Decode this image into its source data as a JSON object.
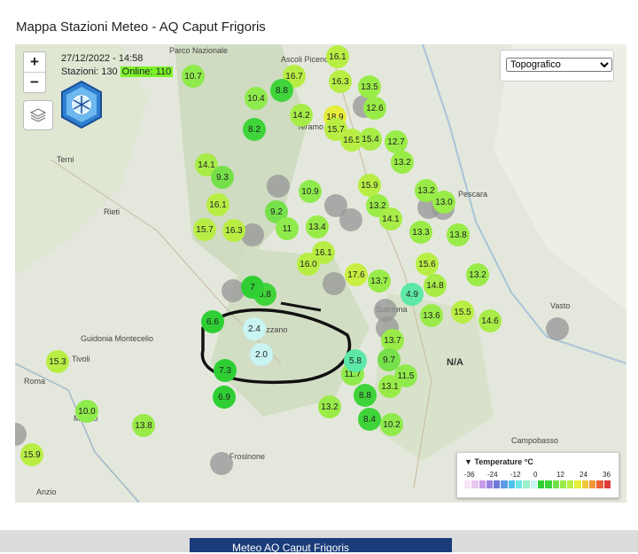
{
  "page": {
    "title": "Mappa Stazioni Meteo - AQ Caput Frigoris"
  },
  "map": {
    "zoom_in": "+",
    "zoom_out": "−",
    "timestamp": "27/12/2022 - 14:58",
    "stations_label": "Stazioni: 130",
    "online_label": "Online: 110",
    "layer_select": {
      "selected": "Topografico",
      "options": [
        "Topografico"
      ]
    },
    "na_label": "N/A",
    "place_labels": [
      "Ascoli Piceno",
      "Teramo",
      "Terni",
      "Rieti",
      "Pescara",
      "Vasto",
      "Roma",
      "Guidonia Montecelio",
      "Frosinone",
      "Campobasso",
      "Sulmona",
      "Avezzano",
      "Tivoli",
      "Marino",
      "Anzio"
    ],
    "stations": [
      {
        "t": "16.1",
        "c": "#b8ee44"
      },
      {
        "t": "16.7",
        "c": "#b8ee44"
      },
      {
        "t": "10.7",
        "c": "#8fea4c"
      },
      {
        "t": "8.8",
        "c": "#3fd43a"
      },
      {
        "t": "16.3",
        "c": "#b8ee44"
      },
      {
        "t": "13.5",
        "c": "#99eb48"
      },
      {
        "t": "10.4",
        "c": "#8fea4c"
      },
      {
        "t": "14.2",
        "c": "#a8ec47"
      },
      {
        "t": "18.9",
        "c": "#e6ee3a"
      },
      {
        "t": "12.6",
        "c": "#99eb48"
      },
      {
        "t": "8.2",
        "c": "#3fd43a"
      },
      {
        "t": "15.7",
        "c": "#b8ee44"
      },
      {
        "t": "16.5",
        "c": "#b8ee44"
      },
      {
        "t": "15.4",
        "c": "#a8ec47"
      },
      {
        "t": "12.7",
        "c": "#99eb48"
      },
      {
        "t": "14.1",
        "c": "#a8ec47"
      },
      {
        "t": "9.3",
        "c": "#76e04a"
      },
      {
        "t": "13.2",
        "c": "#99eb48"
      },
      {
        "t": "15.9",
        "c": "#b8ee44"
      },
      {
        "t": "13.2",
        "c": "#99eb48"
      },
      {
        "t": "10.9",
        "c": "#8fea4c"
      },
      {
        "t": "9.2",
        "c": "#76e04a"
      },
      {
        "t": "13.0",
        "c": "#99eb48"
      },
      {
        "t": "16.1",
        "c": "#b8ee44"
      },
      {
        "t": "13.2",
        "c": "#99eb48"
      },
      {
        "t": "14.1",
        "c": "#a8ec47"
      },
      {
        "t": "15.7",
        "c": "#b8ee44"
      },
      {
        "t": "16.3",
        "c": "#b8ee44"
      },
      {
        "t": "13.4",
        "c": "#99eb48"
      },
      {
        "t": "13.3",
        "c": "#99eb48"
      },
      {
        "t": "13.8",
        "c": "#99eb48"
      },
      {
        "t": "16.0",
        "c": "#b8ee44"
      },
      {
        "t": "16.1",
        "c": "#b8ee44"
      },
      {
        "t": "15.6",
        "c": "#b8ee44"
      },
      {
        "t": "17.6",
        "c": "#c8ef42"
      },
      {
        "t": "13.7",
        "c": "#99eb48"
      },
      {
        "t": "4.9",
        "c": "#5ee8a8"
      },
      {
        "t": "14.8",
        "c": "#a8ec47"
      },
      {
        "t": "13.2",
        "c": "#99eb48"
      },
      {
        "t": "8.8",
        "c": "#3fd43a"
      },
      {
        "t": "7",
        "c": "#2fcf34"
      },
      {
        "t": "13.6",
        "c": "#99eb48"
      },
      {
        "t": "15.5",
        "c": "#b8ee44"
      },
      {
        "t": "14.6",
        "c": "#a8ec47"
      },
      {
        "t": "2.4",
        "c": "#c8f4f2"
      },
      {
        "t": "2.0",
        "c": "#c8f4f2"
      },
      {
        "t": "13.7",
        "c": "#99eb48"
      },
      {
        "t": "9.7",
        "c": "#76e04a"
      },
      {
        "t": "15.3",
        "c": "#b8ee44"
      },
      {
        "t": "7.3",
        "c": "#2fcf34"
      },
      {
        "t": "11.7",
        "c": "#8fea4c"
      },
      {
        "t": "11.5",
        "c": "#8fea4c"
      },
      {
        "t": "13.1",
        "c": "#99eb48"
      },
      {
        "t": "6.9",
        "c": "#2fcf34"
      },
      {
        "t": "8.8",
        "c": "#3fd43a"
      },
      {
        "t": "13.2",
        "c": "#99eb48"
      },
      {
        "t": "10.0",
        "c": "#8fea4c"
      },
      {
        "t": "13.8",
        "c": "#99eb48"
      },
      {
        "t": "8.4",
        "c": "#3fd43a"
      },
      {
        "t": "10.2",
        "c": "#8fea4c"
      },
      {
        "t": "15.9",
        "c": "#b8ee44"
      },
      {
        "t": "6.6",
        "c": "#2fcf34"
      },
      {
        "t": "5.8",
        "c": "#5ee8a8"
      },
      {
        "t": "11",
        "c": "#8fea4c"
      }
    ],
    "legend": {
      "title": "Temperature °C",
      "ticks": [
        "-36",
        "-24",
        "-12",
        "0",
        "12",
        "24",
        "36"
      ],
      "colors": [
        "#f5e6f5",
        "#e8c6f0",
        "#c99ae6",
        "#9a84e0",
        "#6e78d8",
        "#5a9ae6",
        "#4ec0ee",
        "#6ee4e4",
        "#9af0c8",
        "#c8f4f2",
        "#2fcf34",
        "#3fd43a",
        "#76e04a",
        "#99eb48",
        "#b8ee44",
        "#e6ee3a",
        "#f0c83a",
        "#f0963a",
        "#e8603a",
        "#e03a3a"
      ]
    }
  },
  "banner": {
    "text": "Meteo AQ Caput Frigoris"
  }
}
